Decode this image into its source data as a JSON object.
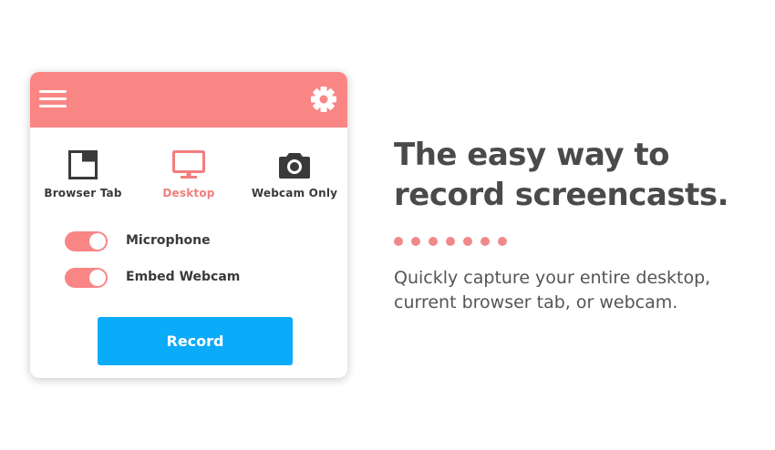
{
  "colors": {
    "accent": "#f98585",
    "accent_text": "#f27e7e",
    "record_button": "#0aabf9",
    "text_dark": "#3a3a3a",
    "dot": "#f08a8a"
  },
  "popup": {
    "header": {
      "menu_icon": "hamburger-menu-icon",
      "settings_icon": "gear-icon"
    },
    "modes": [
      {
        "label": "Browser Tab",
        "icon": "browser-tab-icon",
        "active": false
      },
      {
        "label": "Desktop",
        "icon": "desktop-monitor-icon",
        "active": true
      },
      {
        "label": "Webcam Only",
        "icon": "camera-icon",
        "active": false
      }
    ],
    "toggles": [
      {
        "label": "Microphone",
        "on": true
      },
      {
        "label": "Embed Webcam",
        "on": true
      }
    ],
    "record_label": "Record"
  },
  "promo": {
    "headline_line1": "The easy way to",
    "headline_line2": "record screencasts.",
    "dot_count": 7,
    "tagline_line1": "Quickly capture your entire desktop,",
    "tagline_line2": "current browser tab, or webcam."
  }
}
